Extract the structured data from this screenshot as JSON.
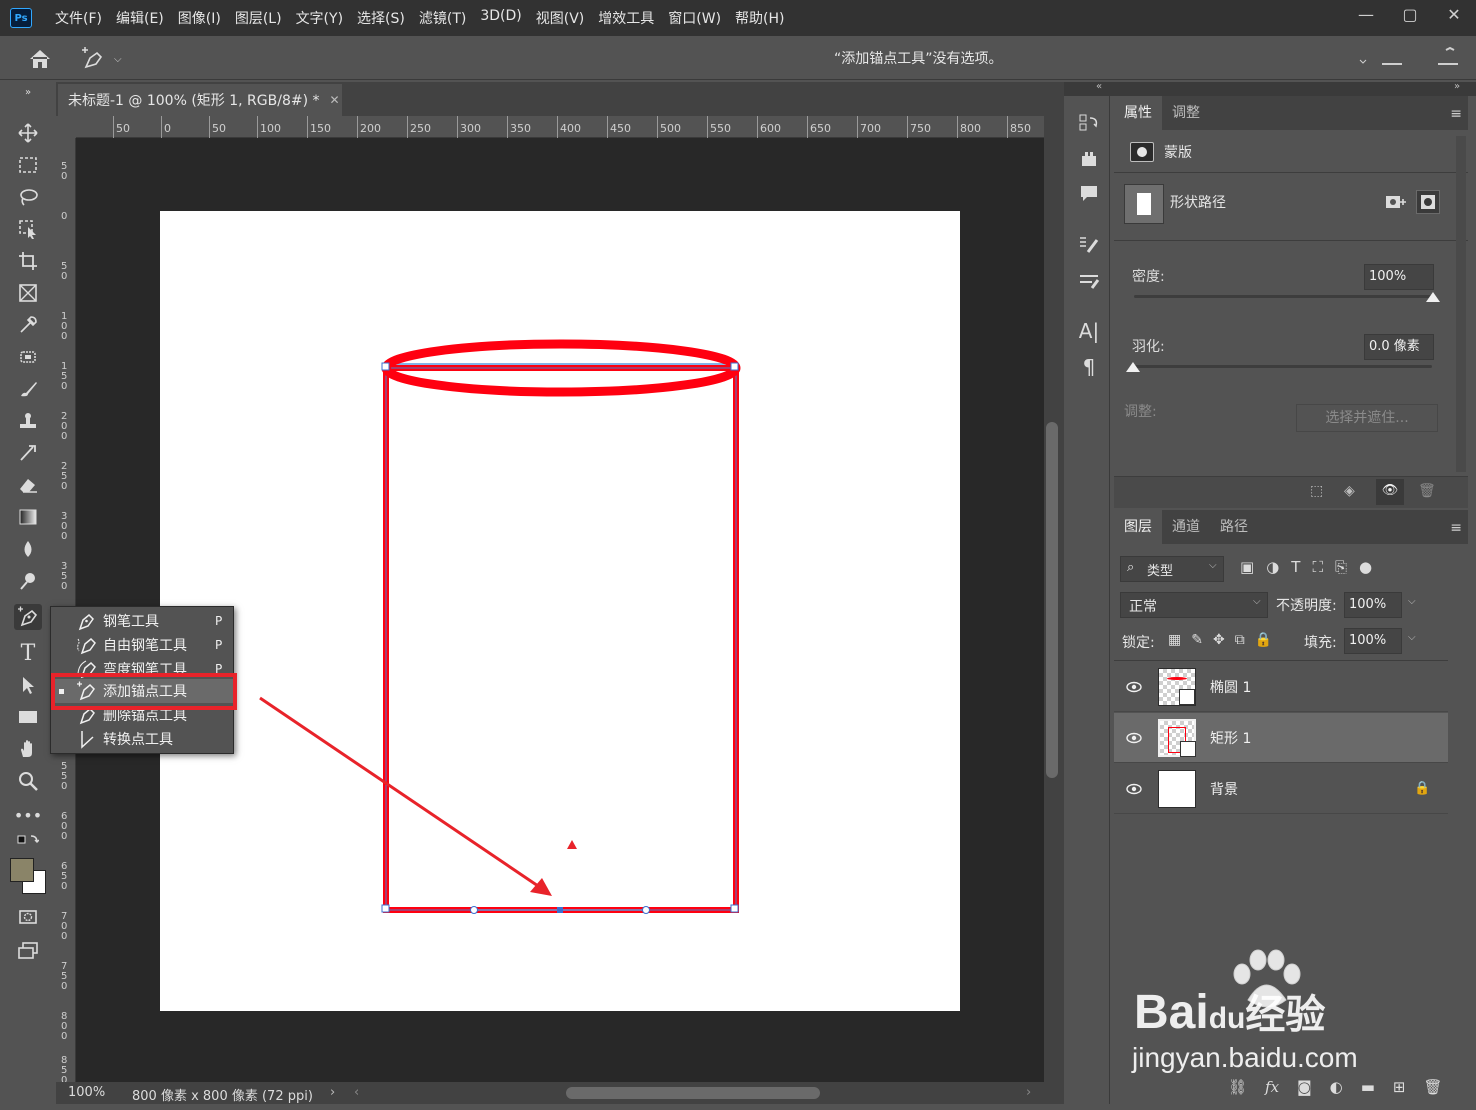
{
  "menubar": {
    "logo": "Ps",
    "items": [
      "文件(F)",
      "编辑(E)",
      "图像(I)",
      "图层(L)",
      "文字(Y)",
      "选择(S)",
      "滤镜(T)",
      "3D(D)",
      "视图(V)",
      "增效工具",
      "窗口(W)",
      "帮助(H)"
    ],
    "controls": [
      "—",
      "▢",
      "✕"
    ]
  },
  "options": {
    "message": "“添加锚点工具”没有选项。"
  },
  "document": {
    "tab_title": "未标题-1 @ 100% (矩形 1, RGB/8#) *",
    "ruler_h": [
      "50",
      "0",
      "50",
      "100",
      "150",
      "200",
      "250",
      "300",
      "350",
      "400",
      "450",
      "500",
      "550",
      "600",
      "650",
      "700",
      "750",
      "800",
      "850"
    ],
    "ruler_v": [
      "50",
      "0",
      "50",
      "100",
      "150",
      "200",
      "250",
      "300",
      "350",
      "400",
      "450",
      "500",
      "550",
      "600",
      "650",
      "700",
      "750",
      "800",
      "850"
    ],
    "zoom": "100%",
    "size_info": "800 像素 x 800 像素 (72 ppi)"
  },
  "flyout": {
    "items": [
      {
        "label": "钢笔工具",
        "key": "P",
        "icon": "pen-icon"
      },
      {
        "label": "自由钢笔工具",
        "key": "P",
        "icon": "freeform-pen-icon"
      },
      {
        "label": "弯度钢笔工具",
        "key": "P",
        "icon": "curvature-pen-icon"
      },
      {
        "label": "添加锚点工具",
        "key": "",
        "icon": "add-anchor-icon",
        "selected": true
      },
      {
        "label": "删除锚点工具",
        "key": "",
        "icon": "delete-anchor-icon"
      },
      {
        "label": "转换点工具",
        "key": "",
        "icon": "convert-point-icon"
      }
    ]
  },
  "properties": {
    "tabs": [
      "属性",
      "调整"
    ],
    "mask_label": "蒙版",
    "shape_path_label": "形状路径",
    "density_label": "密度:",
    "density_value": "100%",
    "feather_label": "羽化:",
    "feather_value": "0.0 像素",
    "adjust_label": "调整:",
    "select_mask_button": "选择并遮住..."
  },
  "layers": {
    "tabs": [
      "图层",
      "通道",
      "路径"
    ],
    "filter_label": "类型",
    "blend_mode": "正常",
    "opacity_label": "不透明度:",
    "opacity_value": "100%",
    "lock_label": "锁定:",
    "fill_label": "填充:",
    "fill_value": "100%",
    "rows": [
      {
        "name": "椭圆 1",
        "selected": false
      },
      {
        "name": "矩形 1",
        "selected": true
      },
      {
        "name": "背景",
        "selected": false,
        "locked": true
      }
    ]
  },
  "watermark": {
    "brand": "Bai",
    "brand_du": "du",
    "brand_cn": "经验",
    "url": "jingyan.baidu.com"
  },
  "colors": {
    "foreground": "#8a8468",
    "background": "#ffffff",
    "path_red": "#ff0010",
    "highlight_red": "#e8232a",
    "accent_blue": "#31a8ff"
  }
}
